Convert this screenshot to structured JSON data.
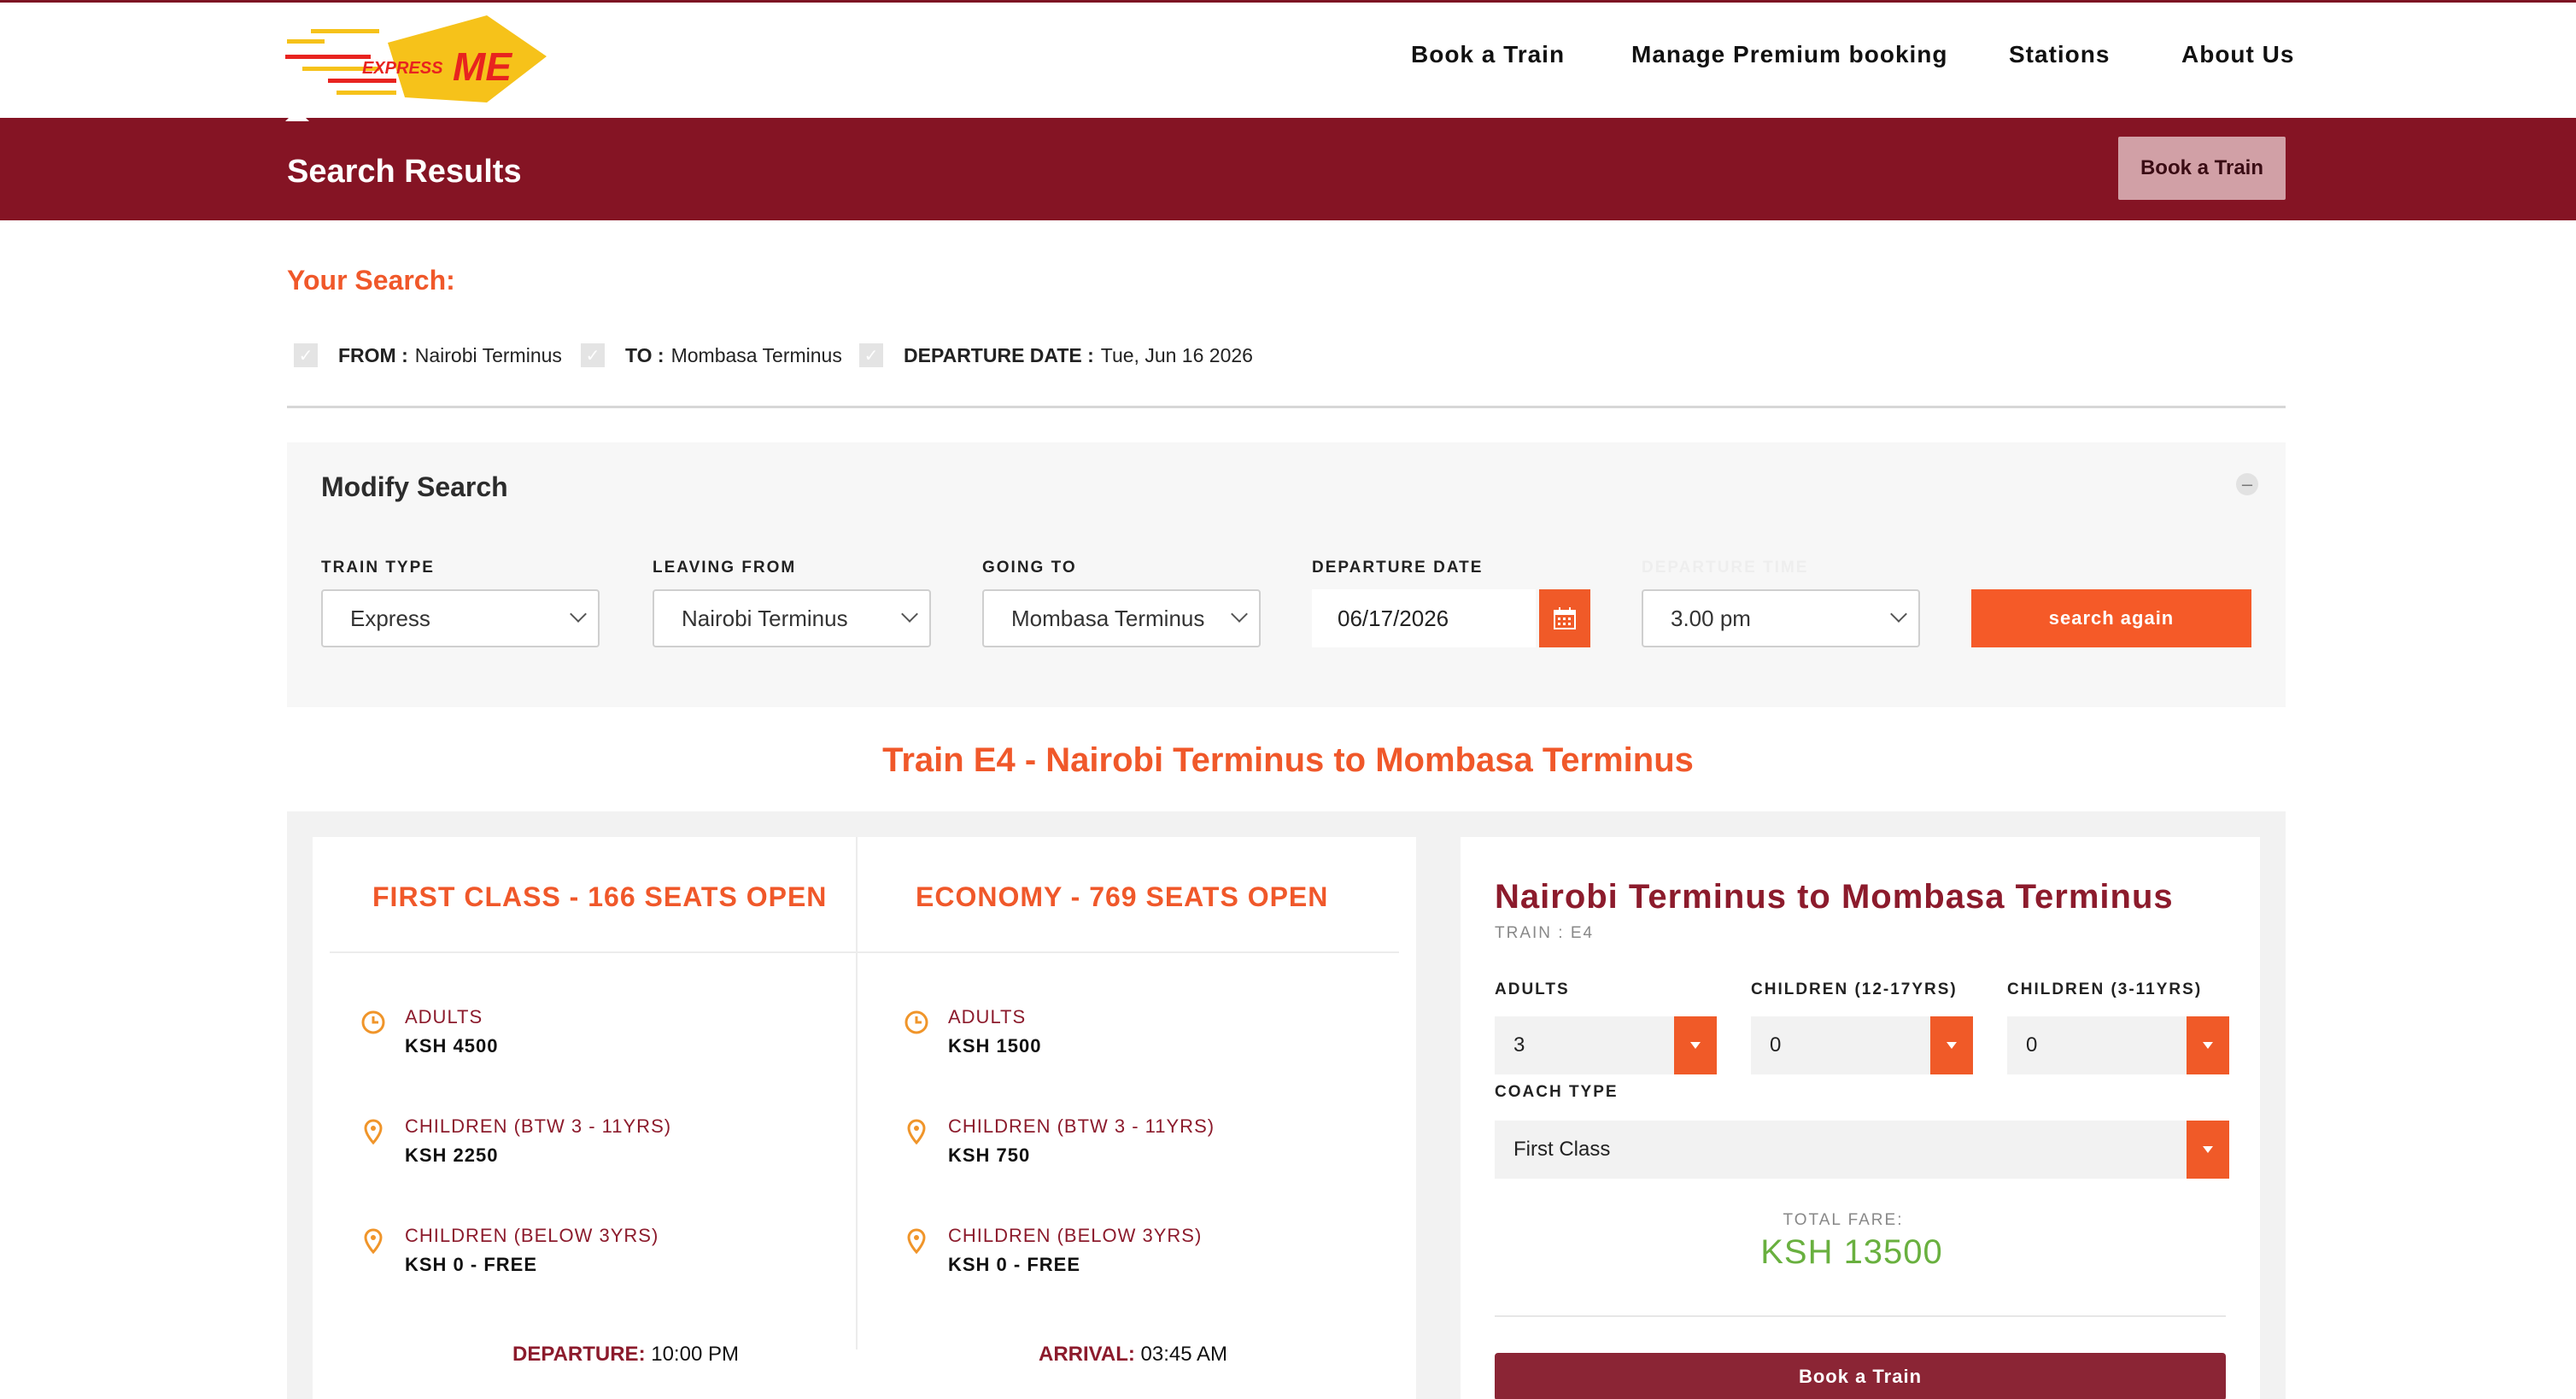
{
  "logo": {
    "line1": "EXPRESS",
    "line2": "ME",
    "colors": {
      "yellow": "#f6c21a",
      "red": "#e8231f"
    }
  },
  "nav": {
    "items": [
      {
        "label": "Book a Train"
      },
      {
        "label": "Manage Premium booking"
      },
      {
        "label": "Stations"
      },
      {
        "label": "About Us"
      }
    ]
  },
  "banner": {
    "title": "Search Results",
    "button": "Book a Train"
  },
  "search": {
    "heading": "Your Search:",
    "criteria": [
      {
        "key": "FROM :",
        "value": "Nairobi Terminus"
      },
      {
        "key": "TO :",
        "value": "Mombasa Terminus"
      },
      {
        "key": "DEPARTURE DATE :",
        "value": "Tue, Jun 16 2026"
      }
    ]
  },
  "modify": {
    "title": "Modify Search",
    "toggle": "–",
    "fields": {
      "train_type": {
        "label": "TRAIN TYPE",
        "value": "Express"
      },
      "leaving_from": {
        "label": "LEAVING FROM",
        "value": "Nairobi Terminus"
      },
      "going_to": {
        "label": "GOING TO",
        "value": "Mombasa Terminus"
      },
      "departure_date": {
        "label": "DEPARTURE DATE",
        "value": "06/17/2026"
      },
      "departure_time": {
        "label": "DEPARTURE TIME",
        "value": "3.00 pm"
      }
    },
    "search_button": "search again"
  },
  "train_title": "Train E4 - Nairobi Terminus to Mombasa Terminus",
  "classes": [
    {
      "title": "FIRST CLASS - 166 SEATS OPEN",
      "fares": [
        {
          "label": "ADULTS",
          "value": "KSH 4500",
          "icon": "clock-icon"
        },
        {
          "label": "CHILDREN (BTW 3 - 11YRS)",
          "value": "KSH 2250",
          "icon": "pin-icon"
        },
        {
          "label": "CHILDREN (BELOW 3YRS)",
          "value": "KSH 0 - FREE",
          "icon": "pin-icon"
        }
      ],
      "time_label": "DEPARTURE:",
      "time_value": "10:00 PM"
    },
    {
      "title": "ECONOMY - 769 SEATS OPEN",
      "fares": [
        {
          "label": "ADULTS",
          "value": "KSH 1500",
          "icon": "clock-icon"
        },
        {
          "label": "CHILDREN (BTW 3 - 11YRS)",
          "value": "KSH 750",
          "icon": "pin-icon"
        },
        {
          "label": "CHILDREN (BELOW 3YRS)",
          "value": "KSH 0 - FREE",
          "icon": "pin-icon"
        }
      ],
      "time_label": "ARRIVAL:",
      "time_value": "03:45 AM"
    }
  ],
  "booking": {
    "title": "Nairobi Terminus to Mombasa Terminus",
    "train": "TRAIN : E4",
    "adults": {
      "label": "ADULTS",
      "value": "3"
    },
    "children_12_17": {
      "label": "CHILDREN (12-17YRS)",
      "value": "0"
    },
    "children_3_11": {
      "label": "CHILDREN (3-11YRS)",
      "value": "0"
    },
    "coach_type": {
      "label": "COACH TYPE",
      "value": "First Class"
    },
    "total_label": "TOTAL FARE:",
    "total_value": "KSH 13500",
    "button": "Book a Train"
  },
  "colors": {
    "maroon": "#851424",
    "orange": "#f05a28",
    "green": "#69b03f"
  }
}
